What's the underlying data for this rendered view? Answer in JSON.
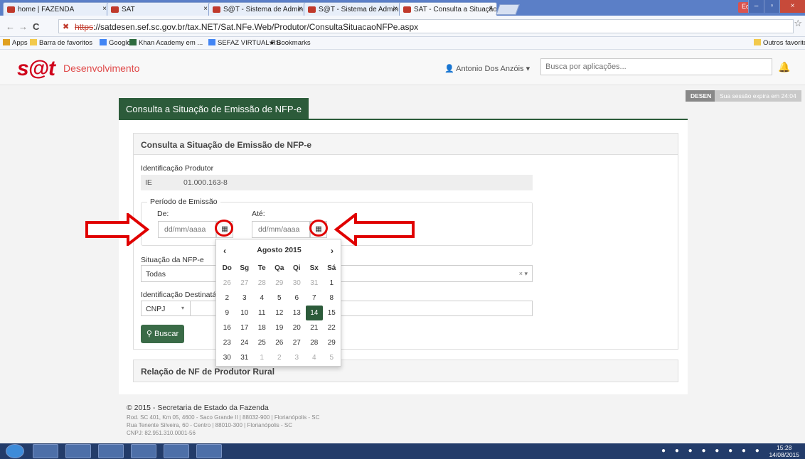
{
  "browser": {
    "tabs": [
      {
        "title": "home | FAZENDA"
      },
      {
        "title": "SAT"
      },
      {
        "title": "S@T - Sistema de Admini"
      },
      {
        "title": "S@T - Sistema de Admini"
      },
      {
        "title": "SAT - Consulta a Situação"
      }
    ],
    "window_user": "Edson",
    "url_scheme": "https",
    "url_rest": "://satdesen.sef.sc.gov.br/tax.NET/Sat.NFe.Web/Produtor/ConsultaSituacaoNFPe.aspx",
    "bookmarks": [
      "Apps",
      "Barra de favoritos",
      "Google",
      "Khan Academy em ...",
      "SEFAZ VIRTUAL RS",
      "Bookmarks"
    ],
    "other_bookmarks": "Outros favoritos"
  },
  "app": {
    "logo": "s@t",
    "env": "Desenvolvimento",
    "user": "Antonio Dos Anzóis",
    "search_placeholder": "Busca por aplicações...",
    "env_badge": "DESEN",
    "session": "Sua sessão expira em 24:04"
  },
  "page": {
    "title": "Consulta a Situação de Emissão de NFP-e",
    "panel_title": "Consulta a Situação de Emissão de NFP-e",
    "id_produtor_label": "Identificação Produtor",
    "ie_label": "IE",
    "ie_value": "01.000.163-8",
    "periodo_label": "Período de Emissão",
    "de_label": "De:",
    "ate_label": "Até:",
    "date_placeholder": "dd/mm/aaaa",
    "situacao_label": "Situação da NFP-e",
    "situacao_value": "Todas",
    "destinatario_label": "Identificação Destinatário",
    "doc_type": "CNPJ",
    "search_button": "Buscar",
    "relacao_title": "Relação de NF de Produtor Rural"
  },
  "calendar": {
    "month_title": "Agosto 2015",
    "prev": "‹",
    "next": "›",
    "weekdays": [
      "Do",
      "Sg",
      "Te",
      "Qa",
      "Qi",
      "Sx",
      "Sá"
    ],
    "weeks": [
      [
        "26",
        "27",
        "28",
        "29",
        "30",
        "31",
        "1"
      ],
      [
        "2",
        "3",
        "4",
        "5",
        "6",
        "7",
        "8"
      ],
      [
        "9",
        "10",
        "11",
        "12",
        "13",
        "14",
        "15"
      ],
      [
        "16",
        "17",
        "18",
        "19",
        "20",
        "21",
        "22"
      ],
      [
        "23",
        "24",
        "25",
        "26",
        "27",
        "28",
        "29"
      ],
      [
        "30",
        "31",
        "1",
        "2",
        "3",
        "4",
        "5"
      ]
    ],
    "today": "14"
  },
  "footer": {
    "line1": "© 2015 - Secretaria de Estado da Fazenda",
    "line2": "Rod. SC 401, Km 05, 4600 - Saco Grande II | 88032-900 | Florianópolis - SC",
    "line3": "Rua Tenente Silveira, 60 - Centro | 88010-300 | Florianópolis - SC",
    "line4": "CNPJ: 82.951.310.0001-56"
  },
  "taskbar": {
    "time": "15:28",
    "date": "14/08/2015"
  },
  "colors": {
    "accent": "#2c5b3a",
    "annotation": "#e00000"
  }
}
